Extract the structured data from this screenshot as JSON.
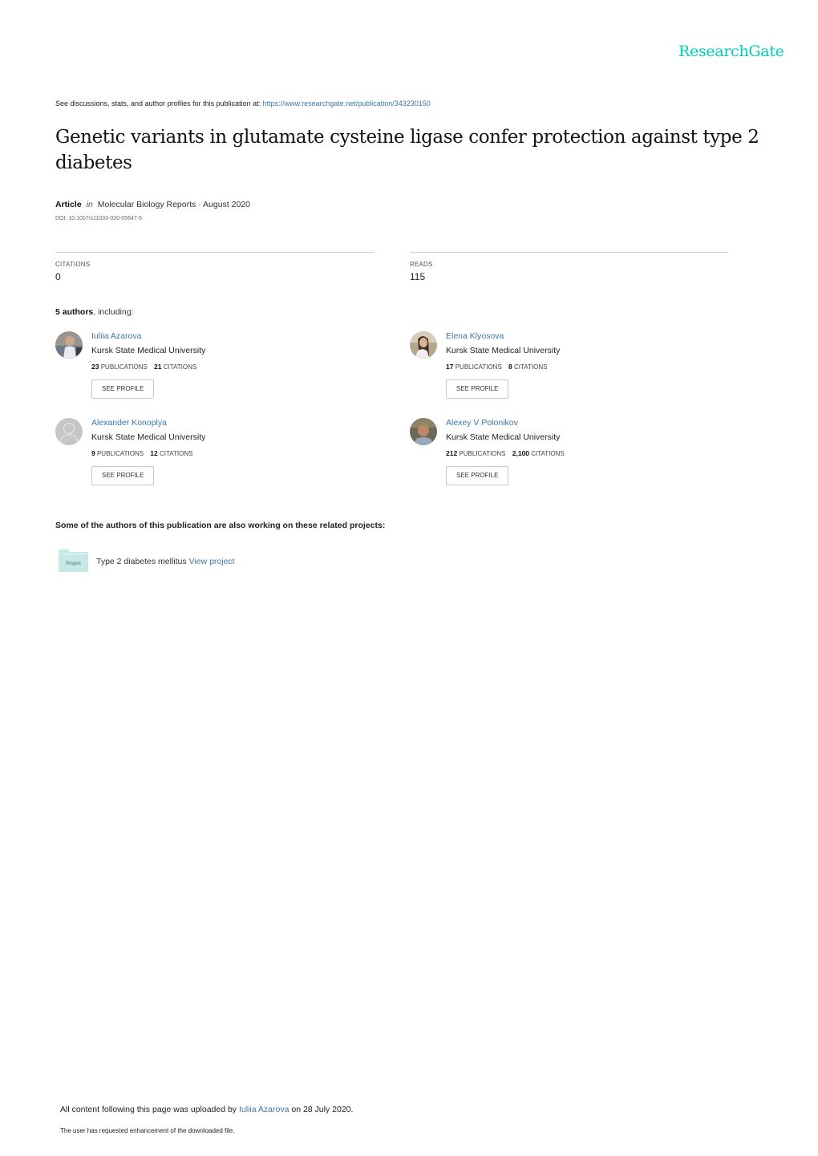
{
  "logo": {
    "text": "ResearchGate",
    "color": "#00ccbb"
  },
  "header": {
    "see_discussions": "See discussions, stats, and author profiles for this publication at:",
    "url": "https://www.researchgate.net/publication/343230150"
  },
  "publication": {
    "title": "Genetic variants in glutamate cysteine ligase confer protection against type 2 diabetes",
    "type": "Article",
    "in": "in",
    "journal_date": "Molecular Biology Reports · August 2020",
    "doi": "DOI: 10.1007/s11033-020-05647-5"
  },
  "stats": {
    "citations": {
      "label": "CITATIONS",
      "value": "0"
    },
    "reads": {
      "label": "READS",
      "value": "115"
    }
  },
  "authors_heading": {
    "count": "5 authors",
    "suffix": ", including:"
  },
  "authors": [
    {
      "name": "Iuliia Azarova",
      "institution": "Kursk State Medical University",
      "publications": "23",
      "citations": "21",
      "pub_label": "PUBLICATIONS",
      "cit_label": "CITATIONS",
      "button": "SEE PROFILE",
      "avatar": "photo"
    },
    {
      "name": "Elena Klyosova",
      "institution": "Kursk State Medical University",
      "publications": "17",
      "citations": "8",
      "pub_label": "PUBLICATIONS",
      "cit_label": "CITATIONS",
      "button": "SEE PROFILE",
      "avatar": "photo"
    },
    {
      "name": "Alexander Konoplya",
      "institution": "Kursk State Medical University",
      "publications": "9",
      "citations": "12",
      "pub_label": "PUBLICATIONS",
      "cit_label": "CITATIONS",
      "button": "SEE PROFILE",
      "avatar": "placeholder"
    },
    {
      "name": "Alexey V Polonikov",
      "institution": "Kursk State Medical University",
      "publications": "212",
      "citations": "2,100",
      "pub_label": "PUBLICATIONS",
      "cit_label": "CITATIONS",
      "button": "SEE PROFILE",
      "avatar": "photo"
    }
  ],
  "related": {
    "heading": "Some of the authors of this publication are also working on these related projects:",
    "projects": [
      {
        "icon_label": "Project",
        "name": "Type 2 diabetes mellitus",
        "link": "View project"
      }
    ]
  },
  "footer": {
    "upload_prefix": "All content following this page was uploaded by",
    "uploader": "Iuliia Azarova",
    "upload_suffix": "on 28 July 2020.",
    "enhancement": "The user has requested enhancement of the downloaded file."
  }
}
